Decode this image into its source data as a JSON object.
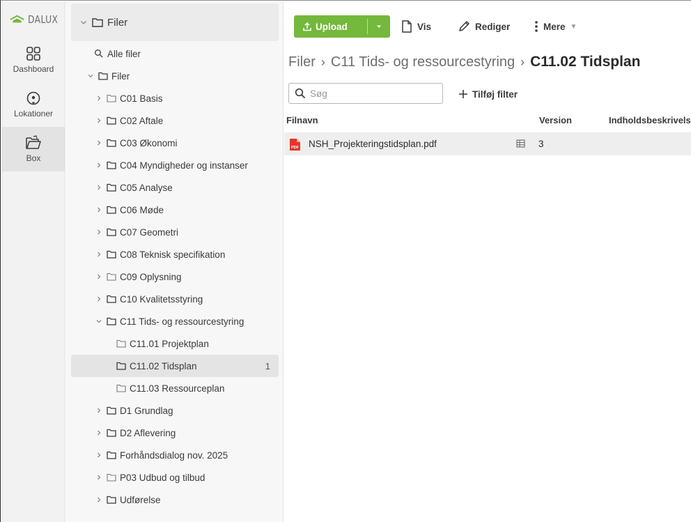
{
  "app": {
    "logo_text": "DALUX",
    "brand_color": "#74b83c"
  },
  "rail": {
    "items": [
      {
        "label": "Dashboard",
        "icon": "grid-icon"
      },
      {
        "label": "Lokationer",
        "icon": "location-pin-icon"
      },
      {
        "label": "Box",
        "icon": "open-folder-icon",
        "active": true
      }
    ]
  },
  "tree": {
    "header": "Filer",
    "all_files": "Alle filer",
    "root": "Filer",
    "folders": [
      {
        "label": "C01 Basis"
      },
      {
        "label": "C02 Aftale"
      },
      {
        "label": "C03 Økonomi"
      },
      {
        "label": "C04 Myndigheder og instanser"
      },
      {
        "label": "C05 Analyse"
      },
      {
        "label": "C06 Møde"
      },
      {
        "label": "C07 Geometri"
      },
      {
        "label": "C08 Teknisk specifikation"
      },
      {
        "label": "C09 Oplysning"
      },
      {
        "label": "C10 Kvalitetsstyring"
      },
      {
        "label": "C11 Tids- og ressourcestyring",
        "expanded": true
      }
    ],
    "subfolders": [
      {
        "label": "C11.01 Projektplan"
      },
      {
        "label": "C11.02 Tidsplan",
        "count": "1",
        "selected": true
      },
      {
        "label": "C11.03 Ressourceplan"
      }
    ],
    "folders_after": [
      {
        "label": "D1 Grundlag"
      },
      {
        "label": "D2 Aflevering"
      },
      {
        "label": "Forhåndsdialog nov. 2025"
      },
      {
        "label": "P03 Udbud og tilbud"
      },
      {
        "label": "Udførelse"
      }
    ]
  },
  "toolbar": {
    "upload_label": "Upload",
    "view_label": "Vis",
    "edit_label": "Rediger",
    "more_label": "Mere"
  },
  "breadcrumb": {
    "items": [
      "Filer",
      "C11 Tids- og ressourcestyring"
    ],
    "current": "C11.02 Tidsplan"
  },
  "search": {
    "placeholder": "Søg",
    "value": ""
  },
  "filter": {
    "add_label": "Tilføj filter"
  },
  "table": {
    "columns": [
      "Filnavn",
      "Version",
      "Indholdsbeskrivels"
    ],
    "rows": [
      {
        "name": "NSH_Projekteringstidsplan.pdf",
        "version": "3",
        "pdf_badge": "PDF"
      }
    ]
  }
}
